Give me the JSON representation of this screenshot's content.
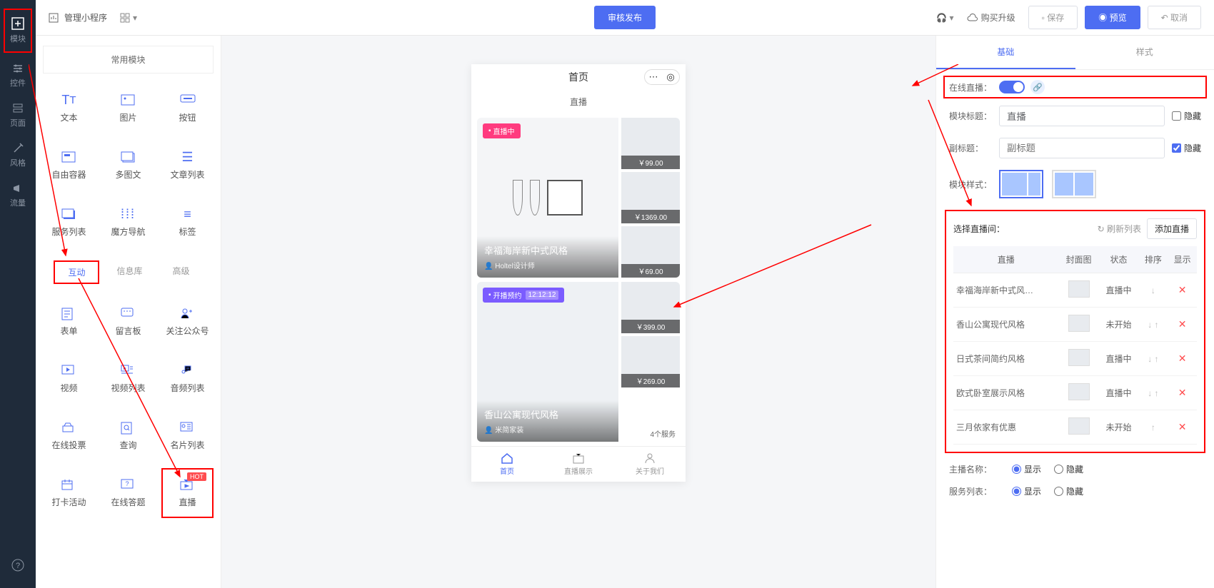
{
  "rail": {
    "items": [
      "模块",
      "控件",
      "页面",
      "风格",
      "流量"
    ]
  },
  "topbar": {
    "manage": "管理小程序",
    "publish": "审核发布",
    "upgrade": "购买升级",
    "save": "保存",
    "preview": "预览",
    "cancel": "取消"
  },
  "modules": {
    "header": "常用模块",
    "row1": [
      "文本",
      "图片",
      "按钮"
    ],
    "row2": [
      "自由容器",
      "多图文",
      "文章列表"
    ],
    "row3": [
      "服务列表",
      "魔方导航",
      "标签"
    ],
    "tabs": [
      "互动",
      "信息库",
      "高级"
    ],
    "row4": [
      "表单",
      "留言板",
      "关注公众号"
    ],
    "row5": [
      "视频",
      "视频列表",
      "音频列表"
    ],
    "row6": [
      "在线投票",
      "查询",
      "名片列表"
    ],
    "row7": [
      "打卡活动",
      "在线答题",
      "直播"
    ],
    "hot": "HOT"
  },
  "phone": {
    "title": "首页",
    "section": "直播",
    "card1": {
      "tag": "直播中",
      "title": "幸福海岸新中式风格",
      "sub": "Holtel设计师",
      "p1": "￥99.00",
      "p2": "￥1369.00",
      "p3": "￥69.00"
    },
    "card2": {
      "tag": "开播预约",
      "time": "12:12:12",
      "title": "香山公寓现代风格",
      "sub": "米简家装",
      "p1": "￥399.00",
      "p2": "￥269.00",
      "count": "4个服务"
    },
    "tabs": [
      "首页",
      "直播展示",
      "关于我们"
    ]
  },
  "right": {
    "tabs": [
      "基础",
      "样式"
    ],
    "online": "在线直播：",
    "modtitle_lbl": "模块标题：",
    "modtitle_val": "直播",
    "hide": "隐藏",
    "subtitle_lbl": "副标题：",
    "subtitle_ph": "副标题",
    "style_lbl": "模块样式：",
    "select_lbl": "选择直播间：",
    "refresh": "刷新列表",
    "add": "添加直播",
    "th": [
      "直播",
      "封面图",
      "状态",
      "排序",
      "显示"
    ],
    "rows": [
      {
        "name": "幸福海岸新中式风…",
        "status": "直播中",
        "order": "↓"
      },
      {
        "name": "香山公寓现代风格",
        "status": "未开始",
        "order": "↓ ↑"
      },
      {
        "name": "日式茶间简约风格",
        "status": "直播中",
        "order": "↓ ↑"
      },
      {
        "name": "欧式卧室展示风格",
        "status": "直播中",
        "order": "↓ ↑"
      },
      {
        "name": "三月依家有优惠",
        "status": "未开始",
        "order": "↑"
      }
    ],
    "anchor_lbl": "主播名称：",
    "service_lbl": "服务列表：",
    "show": "显示",
    "hide2": "隐藏"
  }
}
